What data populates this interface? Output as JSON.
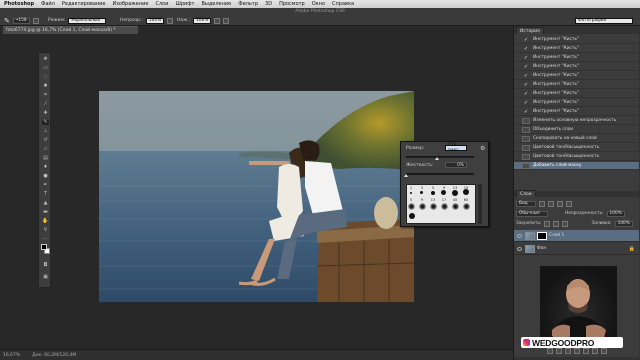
{
  "menubar": {
    "app_name": "Photoshop",
    "items": [
      "Файл",
      "Редактирование",
      "Изображение",
      "Слои",
      "Шрифт",
      "Выделение",
      "Фильтр",
      "3D",
      "Просмотр",
      "Окно",
      "Справка"
    ]
  },
  "window_title": "Adobe Photoshop CS6",
  "options": {
    "mode_label": "Режим:",
    "mode_value": "Нормальный",
    "opacity_label": "Непрозр.:",
    "opacity_value": "100%",
    "flow_label": "Наж.:",
    "flow_value": "100%",
    "workspace": "Фотография"
  },
  "document_tab": "foto6774.jpg @ 16,7% (Слой 1, Слой-маска/8) *",
  "brush_popup": {
    "size_label": "Размер:",
    "size_value": "158 пикс",
    "hardness_label": "Жесткость:",
    "hardness_value": "0%",
    "size_fraction": 0.45,
    "hardness_fraction": 0.0,
    "presets_row1": [
      "1",
      "3",
      "5",
      "9",
      "13",
      "19"
    ],
    "presets_row2": [
      "5",
      "9",
      "13",
      "17",
      "45",
      "65"
    ]
  },
  "history_panel": {
    "tab_label": "История",
    "items": [
      {
        "label": "Инструмент \"Кисть\"",
        "icon": "brush-icon"
      },
      {
        "label": "Инструмент \"Кисть\"",
        "icon": "brush-icon"
      },
      {
        "label": "Инструмент \"Кисть\"",
        "icon": "brush-icon"
      },
      {
        "label": "Инструмент \"Кисть\"",
        "icon": "brush-icon"
      },
      {
        "label": "Инструмент \"Кисть\"",
        "icon": "brush-icon"
      },
      {
        "label": "Инструмент \"Кисть\"",
        "icon": "brush-icon"
      },
      {
        "label": "Инструмент \"Кисть\"",
        "icon": "brush-icon"
      },
      {
        "label": "Инструмент \"Кисть\"",
        "icon": "brush-icon"
      },
      {
        "label": "Инструмент \"Кисть\"",
        "icon": "brush-icon"
      },
      {
        "label": "Изменить основную непрозрачность",
        "icon": "step-icon"
      },
      {
        "label": "Объединить слои",
        "icon": "step-icon"
      },
      {
        "label": "Скопировать на новый слой",
        "icon": "step-icon"
      },
      {
        "label": "Цветовой тон/Насыщенность",
        "icon": "step-icon"
      },
      {
        "label": "Цветовой тон/Насыщенность",
        "icon": "step-icon"
      },
      {
        "label": "Добавить слой-маску",
        "icon": "step-icon"
      }
    ]
  },
  "layers_panel": {
    "tab_label": "Слои",
    "filter_label": "Вид",
    "blend_mode": "Обычные",
    "opacity_label": "Непрозрачность:",
    "opacity_value": "100%",
    "lock_label": "Закрепить:",
    "fill_label": "Заливка:",
    "fill_value": "100%",
    "layers": [
      {
        "name": "Слой 1",
        "has_mask": true
      },
      {
        "name": "Фон",
        "has_mask": false
      }
    ]
  },
  "statusbar": {
    "zoom": "16,67%",
    "doc_info": "Док: 60,2M/120,4M"
  },
  "branding": {
    "handle": "WEDGOODPRO"
  }
}
